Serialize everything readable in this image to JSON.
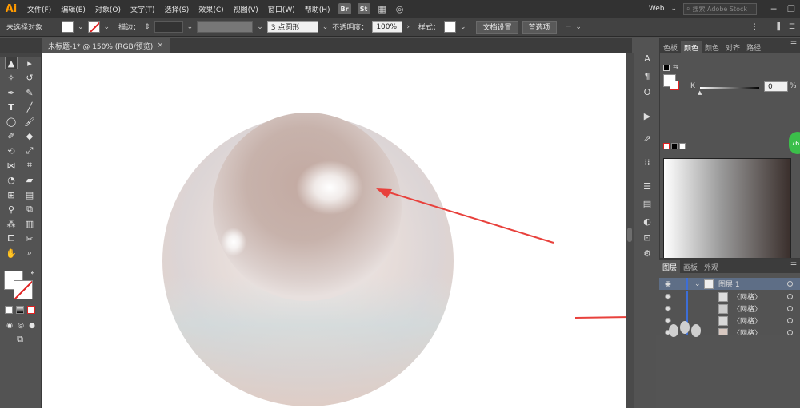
{
  "menubar": {
    "logo": "Ai",
    "items": [
      "文件(F)",
      "编辑(E)",
      "对象(O)",
      "文字(T)",
      "选择(S)",
      "效果(C)",
      "视图(V)",
      "窗口(W)",
      "帮助(H)"
    ],
    "badges": [
      "Br",
      "St"
    ],
    "workspace": "Web",
    "search_placeholder": "搜索 Adobe Stock"
  },
  "control_bar": {
    "selection_label": "未选择对象",
    "stroke_label": "描边：",
    "brush_label": "3 点圆形",
    "opacity_label": "不透明度：",
    "opacity_value": "100%",
    "style_label": "样式：",
    "doc_setup_button": "文档设置",
    "prefs_button": "首选项"
  },
  "document": {
    "tab_title": "未标题-1* @ 150% (RGB/预览)",
    "close_glyph": "×"
  },
  "color_panel": {
    "tabs": [
      "色板",
      "颜色",
      "颜色",
      "对齐",
      "路径"
    ],
    "active_tab": "颜色",
    "channel_label": "K",
    "channel_value": "0",
    "percent": "%"
  },
  "badge": {
    "text": "76"
  },
  "layers_panel": {
    "tabs": [
      "图层",
      "画板",
      "外观"
    ],
    "rows": [
      {
        "name": "图层 1",
        "selected": true
      },
      {
        "name": "〈网格〉",
        "selected": false
      },
      {
        "name": "〈网格〉",
        "selected": false
      },
      {
        "name": "〈网格〉",
        "selected": false
      },
      {
        "name": "〈网格〉",
        "selected": false
      }
    ]
  },
  "colors": {
    "annotation_arrow": "#e8413c",
    "app_dark": "#323232",
    "layer_accent": "#3d6ed6"
  }
}
